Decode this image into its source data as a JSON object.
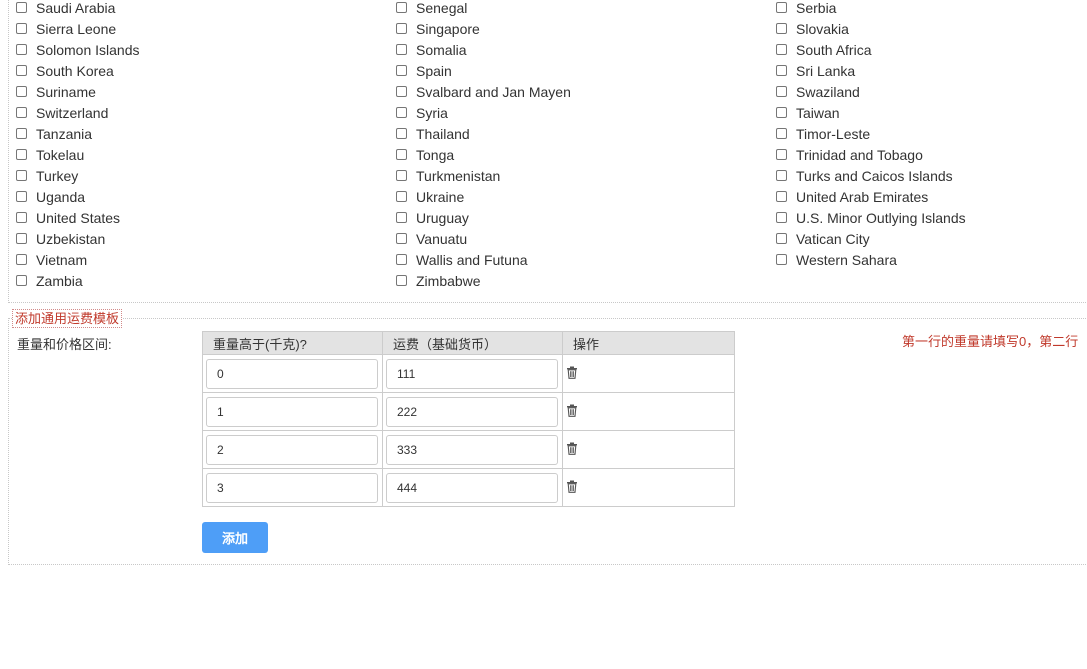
{
  "countries": {
    "col1": [
      "Saudi Arabia",
      "Sierra Leone",
      "Solomon Islands",
      "South Korea",
      "Suriname",
      "Switzerland",
      "Tanzania",
      "Tokelau",
      "Turkey",
      "Uganda",
      "United States",
      "Uzbekistan",
      "Vietnam",
      "Zambia"
    ],
    "col2": [
      "Senegal",
      "Singapore",
      "Somalia",
      "Spain",
      "Svalbard and Jan Mayen",
      "Syria",
      "Thailand",
      "Tonga",
      "Turkmenistan",
      "Ukraine",
      "Uruguay",
      "Vanuatu",
      "Wallis and Futuna",
      "Zimbabwe"
    ],
    "col3": [
      "Serbia",
      "Slovakia",
      "South Africa",
      "Sri Lanka",
      "Swaziland",
      "Taiwan",
      "Timor-Leste",
      "Trinidad and Tobago",
      "Turks and Caicos Islands",
      "United Arab Emirates",
      "U.S. Minor Outlying Islands",
      "Vatican City",
      "Western Sahara"
    ]
  },
  "template": {
    "legend": "添加通用运费模板",
    "range_label": "重量和价格区间:",
    "hint": "第一行的重量请填写0，第二行",
    "headers": [
      "重量高于(千克)?",
      "运费（基础货币）",
      "操作"
    ],
    "rows": [
      {
        "weight": "0",
        "fee": "111"
      },
      {
        "weight": "1",
        "fee": "222"
      },
      {
        "weight": "2",
        "fee": "333"
      },
      {
        "weight": "3",
        "fee": "444"
      }
    ],
    "add_button": "添加"
  },
  "colors": {
    "accent": "#4e9ef7",
    "warning_text": "#c0392b",
    "header_bg": "#e3e3e3"
  },
  "icons": {
    "delete": "trash-icon"
  }
}
